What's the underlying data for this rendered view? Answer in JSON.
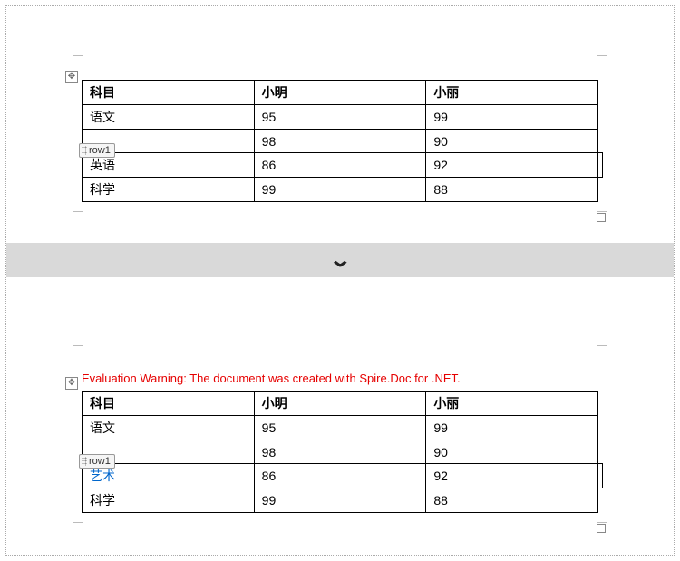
{
  "top_table": {
    "headers": [
      "科目",
      "小明",
      "小丽"
    ],
    "rows": [
      {
        "subject": "语文",
        "c1": "95",
        "c2": "99"
      },
      {
        "subject": "",
        "c1": "98",
        "c2": "90",
        "tag": "row1"
      },
      {
        "subject": "英语",
        "c1": "86",
        "c2": "92",
        "selected": true
      },
      {
        "subject": "科学",
        "c1": "99",
        "c2": "88"
      }
    ]
  },
  "bottom_table": {
    "warning": "Evaluation Warning: The document was created with Spire.Doc for .NET.",
    "headers": [
      "科目",
      "小明",
      "小丽"
    ],
    "rows": [
      {
        "subject": "语文",
        "c1": "95",
        "c2": "99"
      },
      {
        "subject": "",
        "c1": "98",
        "c2": "90",
        "tag": "row1"
      },
      {
        "subject": "艺术",
        "c1": "86",
        "c2": "92",
        "selected": true,
        "subject_class": "blue-text"
      },
      {
        "subject": "科学",
        "c1": "99",
        "c2": "88"
      }
    ]
  },
  "divider_icon": "chevron-down"
}
